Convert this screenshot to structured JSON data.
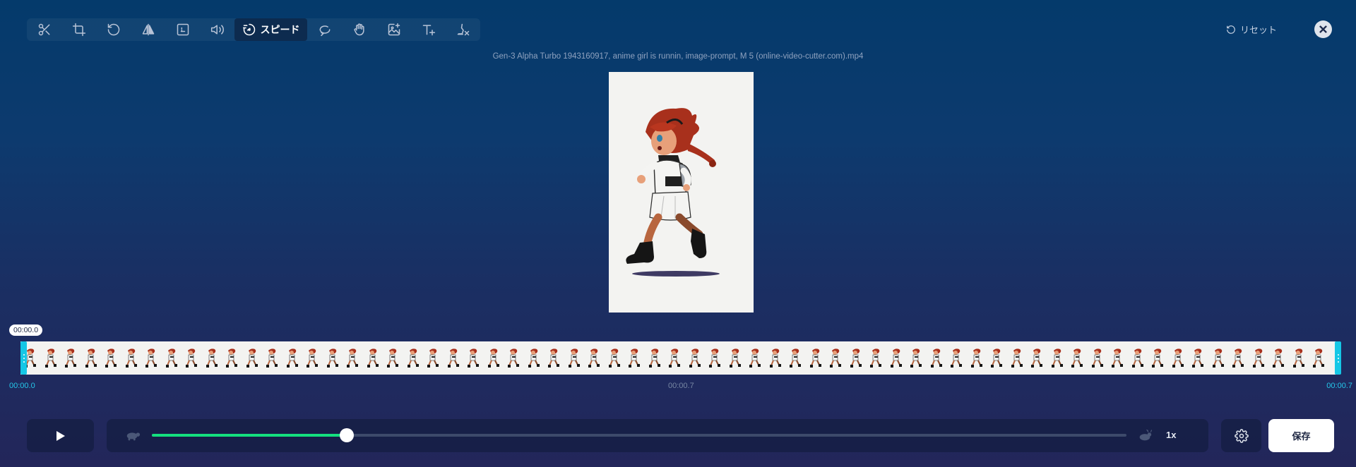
{
  "toolbar": {
    "tools": [
      {
        "name": "cut-icon"
      },
      {
        "name": "crop-icon"
      },
      {
        "name": "rotate-icon"
      },
      {
        "name": "flip-icon"
      },
      {
        "name": "resize-icon"
      },
      {
        "name": "volume-icon"
      },
      {
        "name": "speed-icon",
        "label": "スピード",
        "active": true
      },
      {
        "name": "loop-icon"
      },
      {
        "name": "stabilize-icon"
      },
      {
        "name": "add-image-icon"
      },
      {
        "name": "add-text-icon"
      },
      {
        "name": "remove-watermark-icon"
      }
    ],
    "speed_label": "スピード"
  },
  "header": {
    "reset_label": "リセット",
    "filename": "Gen-3 Alpha Turbo 1943160917, anime girl is runnin, image-prompt, M 5 (online-video-cutter.com).mp4"
  },
  "timeline": {
    "current_time": "00:00.0",
    "start_time": "00:00.0",
    "mid_time": "00:00.7",
    "end_time": "00:00.7",
    "frame_count": 65
  },
  "controls": {
    "speed_value": "1x",
    "speed_fraction": 0.2,
    "save_label": "保存"
  },
  "colors": {
    "accent_green": "#14e07f",
    "handle_cyan": "#15c7e6"
  }
}
